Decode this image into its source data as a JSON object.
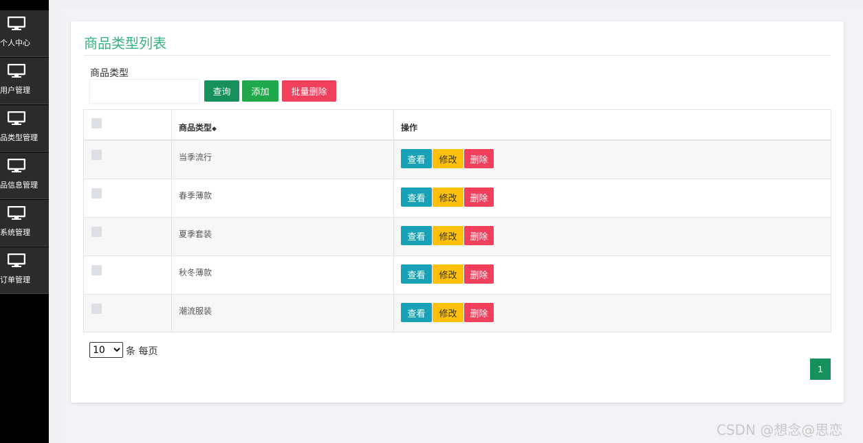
{
  "sidebar": {
    "items": [
      {
        "label": "个人中心",
        "icon": "monitor-icon"
      },
      {
        "label": "用户管理",
        "icon": "monitor-icon"
      },
      {
        "label": "品类型管理",
        "icon": "monitor-icon"
      },
      {
        "label": "品信息管理",
        "icon": "monitor-icon"
      },
      {
        "label": "系统管理",
        "icon": "monitor-icon"
      },
      {
        "label": "订单管理",
        "icon": "monitor-icon"
      }
    ]
  },
  "main": {
    "title": "商品类型列表",
    "filter": {
      "label": "商品类型",
      "value": "",
      "placeholder": ""
    },
    "buttons": {
      "search": "查询",
      "add": "添加",
      "bulk_delete": "批量删除"
    },
    "table": {
      "columns": [
        "商品类型",
        "操作"
      ],
      "sort_icon": "sort-icon",
      "rows": [
        {
          "type": "当季流行"
        },
        {
          "type": "春季薄款"
        },
        {
          "type": "夏季套装"
        },
        {
          "type": "秋冬薄款"
        },
        {
          "type": "潮流服装"
        }
      ],
      "actions": {
        "view": "查看",
        "edit": "修改",
        "delete": "删除"
      }
    },
    "pagination": {
      "page_size": "10",
      "page_size_options": [
        "10"
      ],
      "page_size_label": "条 每页",
      "current_page": "1"
    }
  },
  "watermark": "CSDN @想念@思恋",
  "colors": {
    "accent": "#36b37e",
    "search": "#16915c",
    "add": "#1fa94a",
    "danger": "#f0405c",
    "view": "#17a2b8",
    "edit": "#ffc107"
  }
}
